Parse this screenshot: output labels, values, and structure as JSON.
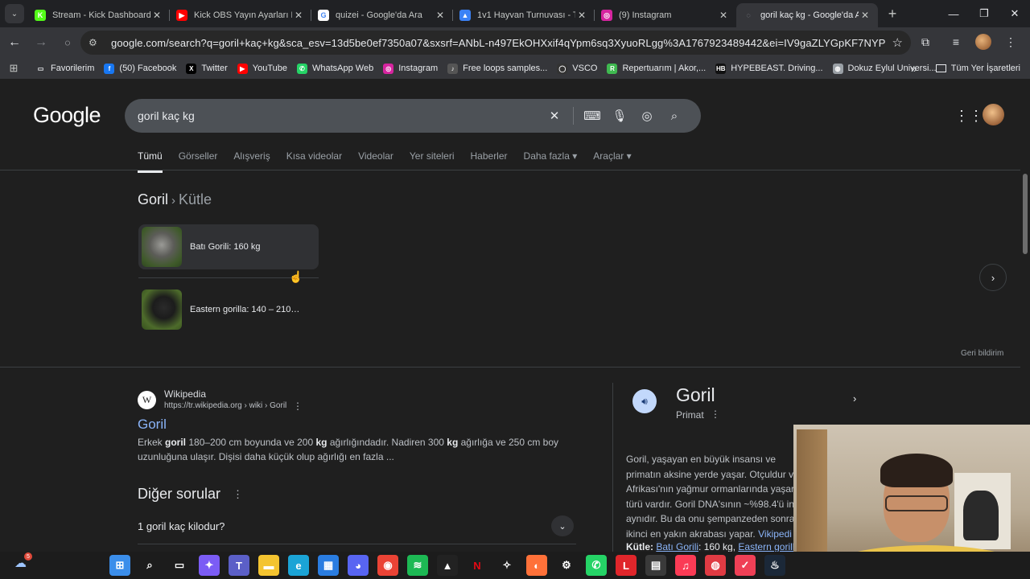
{
  "browser": {
    "tabs": [
      {
        "favicon": "kick-icon",
        "favicon_color": "#53fc18",
        "favicon_text": "K",
        "title": "Stream - Kick Dashboard",
        "active": false
      },
      {
        "favicon": "youtube-icon",
        "favicon_color": "#ff0000",
        "favicon_text": "▶",
        "title": "Kick OBS Yayın Ayarları Na",
        "active": false
      },
      {
        "favicon": "google-icon",
        "favicon_color": "#ffffff",
        "favicon_text": "G",
        "title": "quizei - Google'da Ara",
        "active": false
      },
      {
        "favicon": "image-icon",
        "favicon_color": "#3b82f6",
        "favicon_text": "▲",
        "title": "1v1 Hayvan Turnuvası - Tie",
        "active": false
      },
      {
        "favicon": "instagram-icon",
        "favicon_color": "#d6249f",
        "favicon_text": "◎",
        "title": "(9) Instagram",
        "active": false
      },
      {
        "favicon": "google-icon",
        "favicon_color": "#9aa0a6",
        "favicon_text": "◌",
        "title": "goril kaç kg - Google'da Ar",
        "active": true
      }
    ],
    "new_tab": "+",
    "window_controls": {
      "minimize": "—",
      "maximize": "❐",
      "close": "✕"
    },
    "url": "google.com/search?q=goril+kaç+kg&sca_esv=13d5be0ef7350a07&sxsrf=ANbL-n497EkOHXxif4qYpm6sq3XyuoRLgg%3A1767923489442&ei=IV9gaZLYGpKF7NYPqNCOcQ&oq=gor&gs_l...",
    "bookmarks": [
      {
        "icon": "folder-icon",
        "color": "#e8eaed",
        "glyph": "▭",
        "label": "Favorilerim"
      },
      {
        "icon": "facebook-icon",
        "color": "#1877f2",
        "glyph": "f",
        "label": "(50) Facebook"
      },
      {
        "icon": "x-icon",
        "color": "#000000",
        "glyph": "X",
        "label": "Twitter"
      },
      {
        "icon": "youtube-icon",
        "color": "#ff0000",
        "glyph": "▶",
        "label": "YouTube"
      },
      {
        "icon": "whatsapp-icon",
        "color": "#25d366",
        "glyph": "✆",
        "label": "WhatsApp Web"
      },
      {
        "icon": "instagram-icon",
        "color": "#d6249f",
        "glyph": "◎",
        "label": "Instagram"
      },
      {
        "icon": "loops-icon",
        "color": "#555555",
        "glyph": "♪",
        "label": "Free loops samples..."
      },
      {
        "icon": "vsco-icon",
        "color": "#333333",
        "glyph": "◯",
        "label": "VSCO"
      },
      {
        "icon": "repertuar-icon",
        "color": "#3fb950",
        "glyph": "R",
        "label": "Repertuarım | Akor,..."
      },
      {
        "icon": "hypebeast-icon",
        "color": "#111111",
        "glyph": "HB",
        "label": "HYPEBEAST. Driving..."
      },
      {
        "icon": "globe-icon",
        "color": "#9aa0a6",
        "glyph": "◍",
        "label": "Dokuz Eylul Universi..."
      }
    ],
    "bookmarks_more": "»",
    "all_bookmarks": "Tüm Yer İşaretleri"
  },
  "search": {
    "logo": "Google",
    "query": "goril kaç kg",
    "tabs": [
      "Tümü",
      "Görseller",
      "Alışveriş",
      "Kısa videolar",
      "Videolar",
      "Yer siteleri",
      "Haberler",
      "Daha fazla ▾",
      "Araçlar ▾"
    ],
    "active_tab": 0
  },
  "entity_carousel": {
    "breadcrumb_a": "Goril",
    "breadcrumb_sep": "›",
    "breadcrumb_b": "Kütle",
    "items": [
      {
        "label": "Batı Gorili: 160 kg"
      },
      {
        "label": "Eastern gorilla: 140 – 210…"
      }
    ],
    "next": "›",
    "feedback": "Geri bildirim"
  },
  "result": {
    "site": "Wikipedia",
    "url": "https://tr.wikipedia.org › wiki › Goril",
    "title": "Goril",
    "snippet_parts": [
      "Erkek ",
      "goril",
      " 180–200 cm boyunda ve 200 ",
      "kg",
      " ağırlığındadır. Nadiren 300 ",
      "kg",
      " ağırlığa ve 250 cm boy uzunluğuna ulaşır. Dişisi daha küçük olup ağırlığı en fazla ..."
    ]
  },
  "paa": {
    "title": "Diğer sorular",
    "questions": [
      "1 goril kaç kilodur?"
    ]
  },
  "knowledge_panel": {
    "title": "Goril",
    "subtitle": "Primat",
    "description": "Goril, yaşayan en büyük insansı ve primatın aksine yerde yaşar. Otçuldur ve Afrikası'nın yağmur ormanlarında yaşar. türü vardır. Goril DNA'sının ~%98.4'ü ins aynıdır. Bu da onu şempanzeden sonra i ikinci en yakın akrabası yapar.",
    "source": "Vikipedi",
    "mass_label": "Kütle:",
    "mass_a": "Batı Gorili",
    "mass_value": ": 160 kg,",
    "mass_b": "Eastern gorilla"
  },
  "taskbar": {
    "weather_badge": "5",
    "apps": [
      {
        "name": "start-icon",
        "color": "#3b8eea",
        "glyph": "⊞"
      },
      {
        "name": "search-icon",
        "color": "transparent",
        "glyph": "⌕"
      },
      {
        "name": "taskview-icon",
        "color": "transparent",
        "glyph": "▭"
      },
      {
        "name": "copilot-icon",
        "color": "#7b5cf5",
        "glyph": "✦"
      },
      {
        "name": "teams-icon",
        "color": "#5b5fc7",
        "glyph": "T"
      },
      {
        "name": "explorer-icon",
        "color": "#f4c430",
        "glyph": "▬"
      },
      {
        "name": "edge-icon",
        "color": "#1ba4d6",
        "glyph": "e"
      },
      {
        "name": "store-icon",
        "color": "#2a7de1",
        "glyph": "▦"
      },
      {
        "name": "discord-icon",
        "color": "#5865f2",
        "glyph": "◕"
      },
      {
        "name": "chrome-icon",
        "color": "#ea4335",
        "glyph": "◉"
      },
      {
        "name": "spotify-icon",
        "color": "#1db954",
        "glyph": "≋"
      },
      {
        "name": "affinity-icon",
        "color": "#222222",
        "glyph": "▲"
      },
      {
        "name": "netflix-icon",
        "color": "transparent",
        "glyph": "N"
      },
      {
        "name": "game-icon",
        "color": "transparent",
        "glyph": "✧"
      },
      {
        "name": "firefox-icon",
        "color": "#ff7139",
        "glyph": "◐"
      },
      {
        "name": "steam-alt-icon",
        "color": "transparent",
        "glyph": "⚙"
      },
      {
        "name": "whatsapp-icon",
        "color": "#25d366",
        "glyph": "✆"
      },
      {
        "name": "letterboxd-icon",
        "color": "#e0262b",
        "glyph": "L"
      },
      {
        "name": "teamviewer-icon",
        "color": "#3a3a3a",
        "glyph": "▤"
      },
      {
        "name": "music-icon",
        "color": "#fb3b55",
        "glyph": "♫"
      },
      {
        "name": "record-icon",
        "color": "#e03b43",
        "glyph": "◍"
      },
      {
        "name": "pocket-icon",
        "color": "#ef4056",
        "glyph": "✓"
      },
      {
        "name": "steam-icon",
        "color": "#1b2838",
        "glyph": "♨"
      }
    ]
  },
  "colors": {
    "page_bg": "#1f1f1f",
    "link": "#8ab4f8",
    "chrome_bg": "#35363a"
  }
}
